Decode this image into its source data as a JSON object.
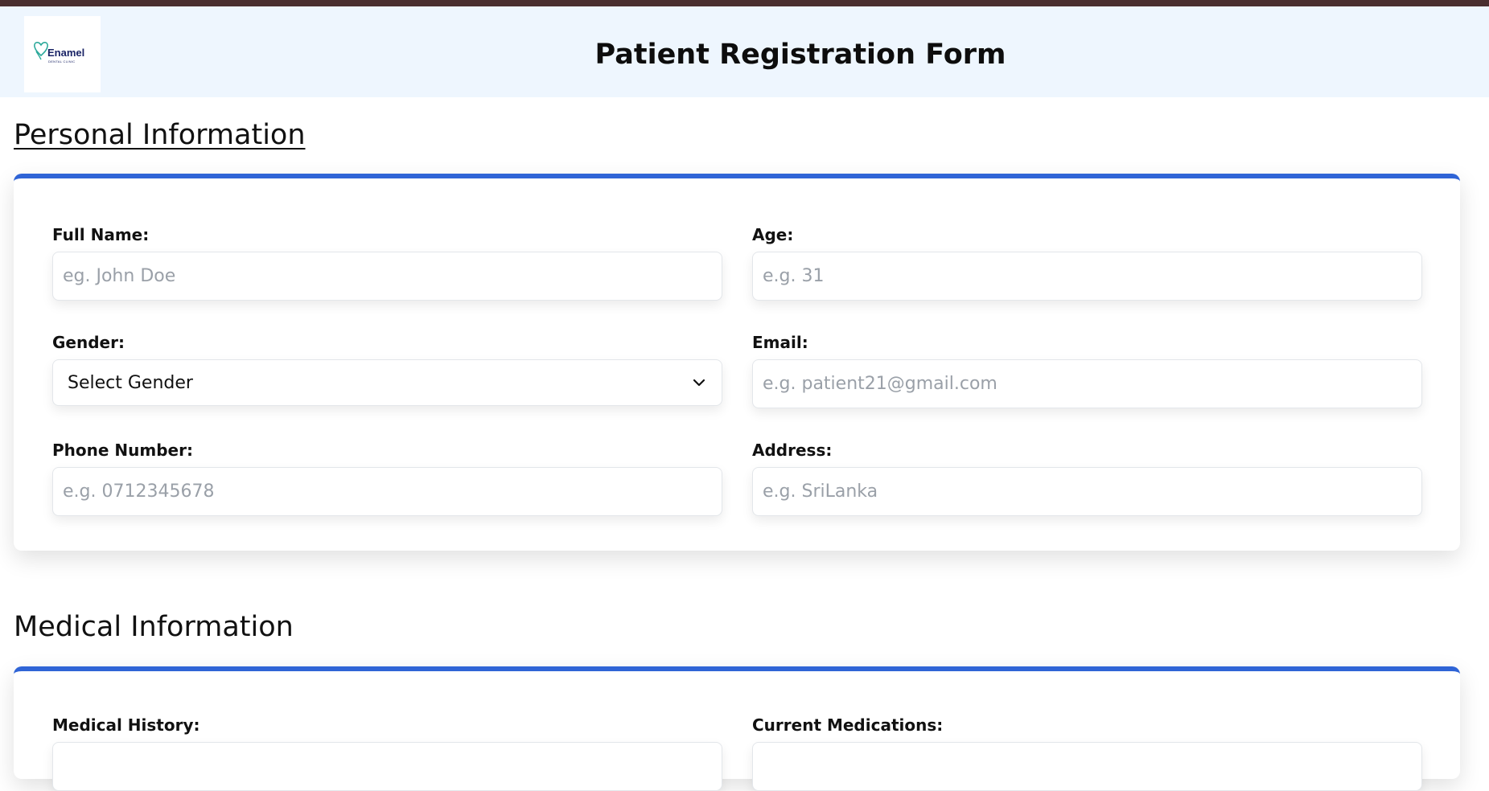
{
  "header": {
    "title": "Patient Registration Form",
    "logo_name": "Enamel",
    "logo_subtitle": "DENTAL CLINIC",
    "brand_color": "#1a2466",
    "background": "#eef6fe"
  },
  "accent_color": "#2f64d6",
  "sections": {
    "personal": {
      "heading": "Personal Information",
      "fields": {
        "full_name": {
          "label": "Full Name:",
          "placeholder": "eg. John Doe"
        },
        "age": {
          "label": "Age:",
          "placeholder": "e.g. 31"
        },
        "gender": {
          "label": "Gender:",
          "selected": "Select Gender"
        },
        "email": {
          "label": "Email:",
          "placeholder": "e.g. patient21@gmail.com"
        },
        "phone": {
          "label": "Phone Number:",
          "placeholder": "e.g. 0712345678"
        },
        "address": {
          "label": "Address:",
          "placeholder": "e.g. SriLanka"
        }
      }
    },
    "medical": {
      "heading": "Medical Information",
      "fields": {
        "history": {
          "label": "Medical History:"
        },
        "medications": {
          "label": "Current Medications:"
        }
      }
    }
  }
}
